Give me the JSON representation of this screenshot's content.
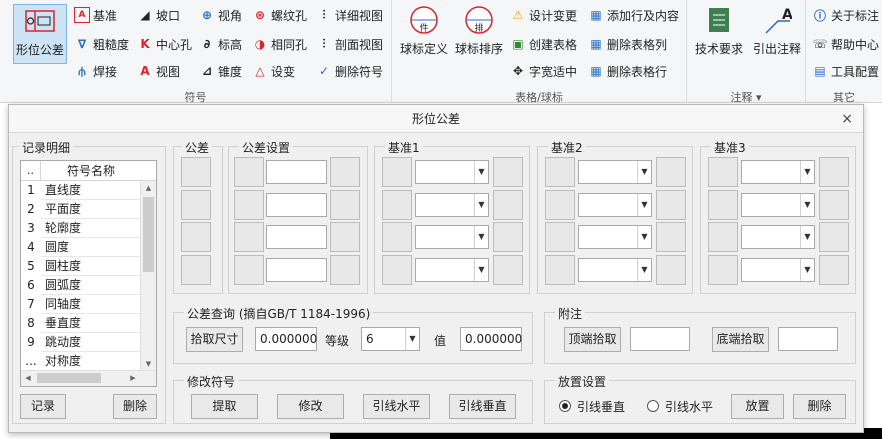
{
  "ribbon": {
    "symbol_group": {
      "label": "符号",
      "big_button": "形位公差",
      "items": [
        "基准",
        "坡口",
        "视角",
        "螺纹孔",
        "详细视图",
        "粗糙度",
        "中心孔",
        "标高",
        "相同孔",
        "剖面视图",
        "焊接",
        "视图",
        "锥度",
        "设变",
        "删除符号"
      ]
    },
    "table_group": {
      "label": "表格/球标",
      "big_buttons": [
        "球标定义",
        "球标排序"
      ],
      "items": [
        "设计变更",
        "添加行及内容",
        "创建表格",
        "删除表格列",
        "字宽适中",
        "删除表格行"
      ],
      "big1_glyph": "件",
      "big2_glyph": "排"
    },
    "annot_group": {
      "label": "注释",
      "big_buttons": [
        "技术要求",
        "引出注释"
      ],
      "arrow": "▾",
      "glyph": "A"
    },
    "other_group": {
      "label": "其它",
      "items": [
        "关于标注",
        "帮助中心",
        "工具配置"
      ]
    }
  },
  "dialog": {
    "title": "形位公差",
    "close": "×",
    "records": {
      "label": "记录明细",
      "header_index": "..",
      "header_name": "符号名称",
      "rows": [
        {
          "i": "1",
          "name": "直线度"
        },
        {
          "i": "2",
          "name": "平面度"
        },
        {
          "i": "3",
          "name": "轮廓度"
        },
        {
          "i": "4",
          "name": "圆度"
        },
        {
          "i": "5",
          "name": "圆柱度"
        },
        {
          "i": "6",
          "name": "圆弧度"
        },
        {
          "i": "7",
          "name": "同轴度"
        },
        {
          "i": "8",
          "name": "垂直度"
        },
        {
          "i": "9",
          "name": "跳动度"
        },
        {
          "i": "...",
          "name": "对称度"
        }
      ],
      "record_button": "记录",
      "delete_button": "删除"
    },
    "tolerance_label": "公差",
    "tolerance_settings_label": "公差设置",
    "datum1_label": "基准1",
    "datum2_label": "基准2",
    "datum3_label": "基准3",
    "query": {
      "label": "公差查询 (摘自GB/T 1184-1996)",
      "pick_button": "拾取尺寸",
      "size_value": "0.000000",
      "grade_label": "等级",
      "grade_value": "6",
      "value_label": "值",
      "result_value": "0.000000"
    },
    "note": {
      "label": "附注",
      "top_pick": "顶端拾取",
      "bottom_pick": "底端拾取"
    },
    "modify": {
      "label": "修改符号",
      "pick": "提取",
      "modify": "修改",
      "leader_h": "引线水平",
      "leader_v": "引线垂直"
    },
    "place": {
      "label": "放置设置",
      "radio_v": "引线垂直",
      "radio_h": "引线水平",
      "place_button": "放置",
      "delete_button": "删除"
    }
  },
  "colors": {
    "accent_red": "#d9252a",
    "accent_blue": "#2b6cc4",
    "selected_bg": "#cde4f7"
  }
}
